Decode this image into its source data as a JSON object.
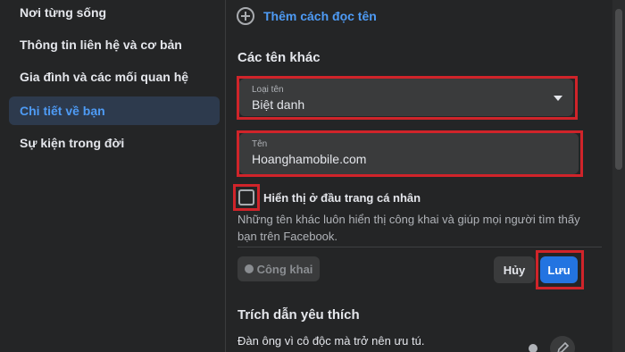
{
  "sidebar": {
    "items": [
      {
        "label": "Nơi từng sống"
      },
      {
        "label": "Thông tin liên hệ và cơ bản"
      },
      {
        "label": "Gia đình và các mối quan hệ"
      },
      {
        "label": "Chi tiết về bạn",
        "active": true
      },
      {
        "label": "Sự kiện trong đời"
      }
    ]
  },
  "main": {
    "add_pronunciation_label": "Thêm cách đọc tên",
    "other_names_title": "Các tên khác",
    "name_type": {
      "label": "Loại tên",
      "value": "Biệt danh"
    },
    "name_field": {
      "label": "Tên",
      "value": "Hoanghamobile.com"
    },
    "show_at_top": {
      "label": "Hiển thị ở đầu trang cá nhân",
      "checked": false
    },
    "help_text": "Những tên khác luôn hiển thị công khai và giúp mọi người tìm thấy bạn trên Facebook.",
    "privacy_label": "Công khai",
    "cancel_label": "Hủy",
    "save_label": "Lưu",
    "quotes_title": "Trích dẫn yêu thích",
    "quote_text": "Đàn ông vì cô độc mà trở nên ưu tú."
  },
  "colors": {
    "accent": "#2374e1",
    "link": "#4e9bf5",
    "highlight_box": "#d0242a",
    "background": "#242526"
  }
}
